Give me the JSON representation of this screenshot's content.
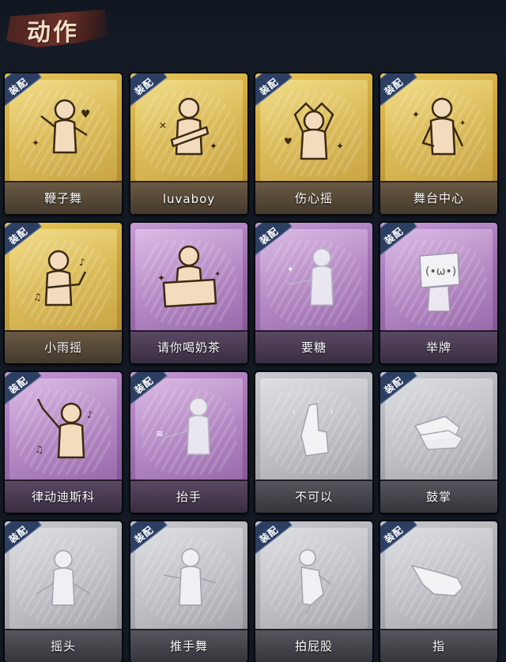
{
  "header": {
    "title": "动作"
  },
  "equip_tag": "装配",
  "cards": [
    {
      "label": "鞭子舞",
      "tier": "gold",
      "icon": "figure-whip-dance-icon"
    },
    {
      "label": "luvaboy",
      "tier": "gold",
      "icon": "figure-cross-arms-icon"
    },
    {
      "label": "伤心摇",
      "tier": "gold",
      "icon": "figure-heart-hands-icon"
    },
    {
      "label": "舞台中心",
      "tier": "gold",
      "icon": "figure-stage-pose-icon"
    },
    {
      "label": "小雨摇",
      "tier": "gold",
      "icon": "figure-rain-dance-icon"
    },
    {
      "label": "请你喝奶茶",
      "tier": "purple",
      "icon": "figure-holding-sign-icon"
    },
    {
      "label": "要糖",
      "tier": "purple",
      "icon": "figure-asking-candy-icon"
    },
    {
      "label": "举牌",
      "tier": "purple",
      "icon": "figure-raise-sign-icon"
    },
    {
      "label": "律动迪斯科",
      "tier": "purple",
      "icon": "figure-disco-icon"
    },
    {
      "label": "抬手",
      "tier": "purple",
      "icon": "figure-raise-hand-icon"
    },
    {
      "label": "不可以",
      "tier": "silver",
      "icon": "finger-wag-icon"
    },
    {
      "label": "鼓掌",
      "tier": "silver",
      "icon": "clapping-hands-icon"
    },
    {
      "label": "摇头",
      "tier": "silver",
      "icon": "figure-shake-head-icon"
    },
    {
      "label": "推手舞",
      "tier": "silver",
      "icon": "figure-push-hands-icon"
    },
    {
      "label": "拍屁股",
      "tier": "silver",
      "icon": "figure-slap-butt-icon"
    },
    {
      "label": "指",
      "tier": "silver",
      "icon": "pointing-hand-icon"
    }
  ]
}
